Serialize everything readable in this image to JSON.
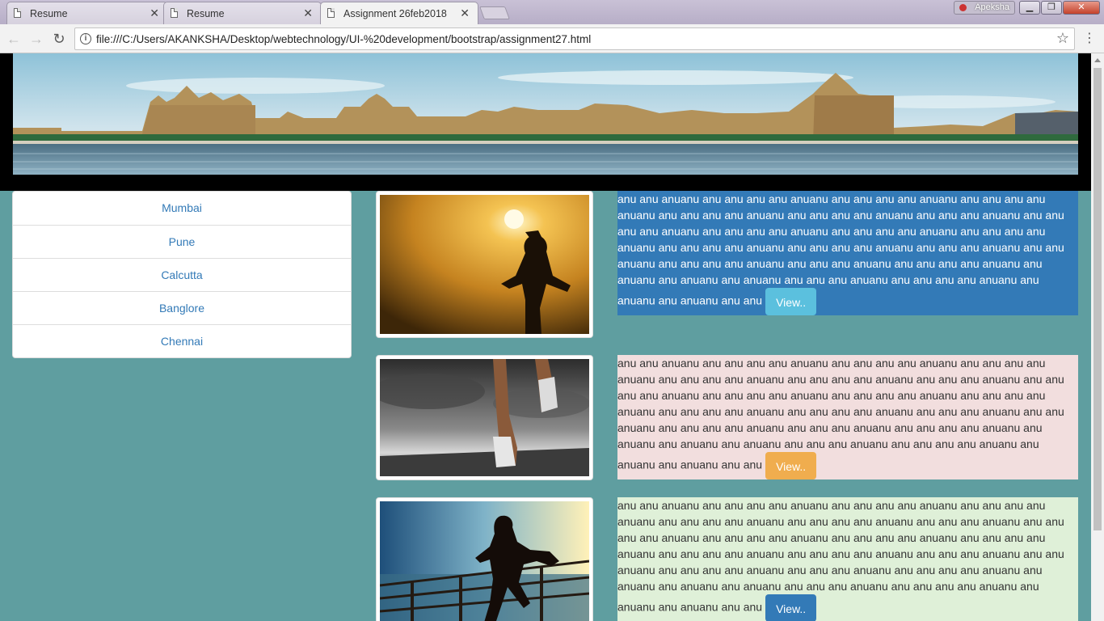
{
  "browser": {
    "tabs": [
      {
        "title": "Resume",
        "active": false
      },
      {
        "title": "Resume",
        "active": false
      },
      {
        "title": "Assignment 26feb2018",
        "active": true
      }
    ],
    "profile_name": "Apeksha",
    "url": "file:///C:/Users/AKANKSHA/Desktop/webtechnology/UI-%20development/bootstrap/assignment27.html"
  },
  "page": {
    "cities": [
      "Mumbai",
      "Pune",
      "Calcutta",
      "Banglore",
      "Chennai"
    ],
    "media": [
      {
        "image": "woman-running-sunset-image",
        "text": "anu anu anuanu anu anu anu anu anuanu anu anu anu anu anuanu anu anu anu anu anuanu anu anu anu anu anuanu anu anu anu anu anuanu anu anu anu anuanu anu anu anu anu anuanu anu anu anu anu anuanu anu anu anu anu anuanu anu anu anu anu anuanu anu anu anu anu anuanu anu anu anu anu anuanu anu anu anu anuanu anu anu anuanu anu anu anu anu anuanu anu anu anu anuanu anu anu anu anu anuanu anu anuanu anu anuanu anu anuanu anu anu anu anuanu anu anu anu anu anuanu anu anuanu anu anuanu anu anu",
        "button": "View..",
        "style": "primary",
        "button_style": "info"
      },
      {
        "image": "runner-feet-road-image",
        "text": "anu anu anuanu anu anu anu anu anuanu anu anu anu anu anuanu anu anu anu anu anuanu anu anu anu anu anuanu anu anu anu anu anuanu anu anu anu anuanu anu anu anu anu anuanu anu anu anu anu anuanu anu anu anu anu anuanu anu anu anu anu anuanu anu anu anu anu anuanu anu anu anu anu anuanu anu anu anu anuanu anu anu anuanu anu anu anu anu anuanu anu anu anu anuanu anu anu anu anu anuanu anu anuanu anu anuanu anu anuanu anu anu anu anuanu anu anu anu anu anuanu anu anuanu anu anuanu anu anu",
        "button": "View..",
        "style": "danger",
        "button_style": "warning"
      },
      {
        "image": "woman-running-pier-image",
        "text": "anu anu anuanu anu anu anu anu anuanu anu anu anu anu anuanu anu anu anu anu anuanu anu anu anu anu anuanu anu anu anu anu anuanu anu anu anu anuanu anu anu anu anu anuanu anu anu anu anu anuanu anu anu anu anu anuanu anu anu anu anu anuanu anu anu anu anu anuanu anu anu anu anu anuanu anu anu anu anuanu anu anu anuanu anu anu anu anu anuanu anu anu anu anuanu anu anu anu anu anuanu anu anuanu anu anuanu anu anuanu anu anu anu anuanu anu anu anu anu anuanu anu anuanu anu anuanu anu anu",
        "button": "View..",
        "style": "success",
        "button_style": "primary"
      }
    ]
  },
  "colors": {
    "page_background": "#5f9ea0",
    "link": "#337ab7"
  }
}
